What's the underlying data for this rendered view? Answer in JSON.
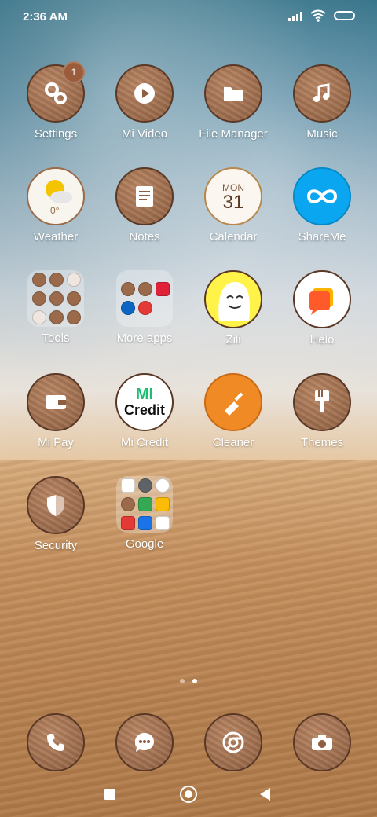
{
  "status_bar": {
    "time": "2:36 AM"
  },
  "apps": [
    {
      "label": "Settings",
      "icon": "gear-icon",
      "badge": "1"
    },
    {
      "label": "Mi Video",
      "icon": "play-icon"
    },
    {
      "label": "File Manager",
      "icon": "folder-icon"
    },
    {
      "label": "Music",
      "icon": "music-note-icon"
    },
    {
      "label": "Weather",
      "icon": "weather-icon",
      "temp": "0°"
    },
    {
      "label": "Notes",
      "icon": "notes-icon"
    },
    {
      "label": "Calendar",
      "icon": "calendar-icon",
      "day": "MON",
      "date": "31"
    },
    {
      "label": "ShareMe",
      "icon": "shareme-icon"
    },
    {
      "label": "Tools",
      "icon": "folder-icon"
    },
    {
      "label": "More apps",
      "icon": "folder-icon"
    },
    {
      "label": "Zili",
      "icon": "zili-icon"
    },
    {
      "label": "Helo",
      "icon": "helo-icon"
    },
    {
      "label": "Mi Pay",
      "icon": "wallet-icon"
    },
    {
      "label": "Mi Credit",
      "icon": "mi-credit-icon",
      "logo_top": "MI",
      "logo_bottom": "Credit"
    },
    {
      "label": "Cleaner",
      "icon": "broom-icon"
    },
    {
      "label": "Themes",
      "icon": "brush-icon"
    },
    {
      "label": "Security",
      "icon": "shield-icon"
    },
    {
      "label": "Google",
      "icon": "folder-icon"
    }
  ],
  "page_indicator": {
    "pages": 2,
    "active": 2
  },
  "dock": [
    {
      "icon": "phone-icon"
    },
    {
      "icon": "messages-icon"
    },
    {
      "icon": "browser-icon"
    },
    {
      "icon": "camera-icon"
    }
  ]
}
